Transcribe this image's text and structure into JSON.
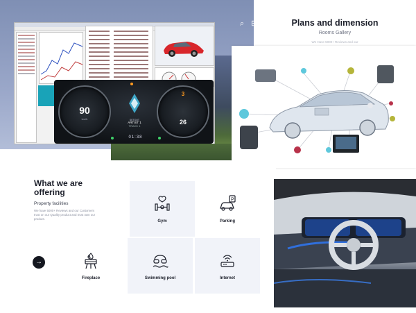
{
  "website": {
    "header_icons": [
      {
        "name": "search-icon",
        "glyph": "⌕"
      },
      {
        "name": "grid-menu-icon",
        "glyph": "⊞"
      }
    ],
    "plans": {
      "title": "Plans and dimension",
      "subtitle": "Rooms Gallery",
      "note": "We Have 5000+ Reviews and our"
    },
    "offering": {
      "title": "What we are offering",
      "section_label": "Property facilities",
      "description": "We have 5000+ Reviews and our Customers trust on our Quality product and trust own our product.",
      "tiles": [
        {
          "icon": "gym-icon",
          "label": "Gym"
        },
        {
          "icon": "parking-icon",
          "label": "Parking"
        },
        {
          "icon": "fireplace-icon",
          "label": "Fireplace"
        },
        {
          "icon": "swimming-pool-icon",
          "label": "Swimming pool"
        },
        {
          "icon": "internet-icon",
          "label": "Internet"
        }
      ]
    }
  },
  "cluster": {
    "speed": "90",
    "speed_unit": "km/h",
    "gear": "3",
    "right_value": "26",
    "center_title": "ARTIST 1",
    "center_sub": "TRACK 1",
    "time": "01:38",
    "status_text": "SETOUT"
  },
  "colors": {
    "accent_dark": "#14171f",
    "tile_bg": "#f1f3f9",
    "hero_bg": "#8d9bbf",
    "diagram_teal": "#5ec8dc",
    "diagram_olive": "#b5b53a",
    "diagram_red": "#b8324a",
    "dashboard_green": "#3fd16a",
    "dashboard_orange": "#ff9a1f"
  }
}
